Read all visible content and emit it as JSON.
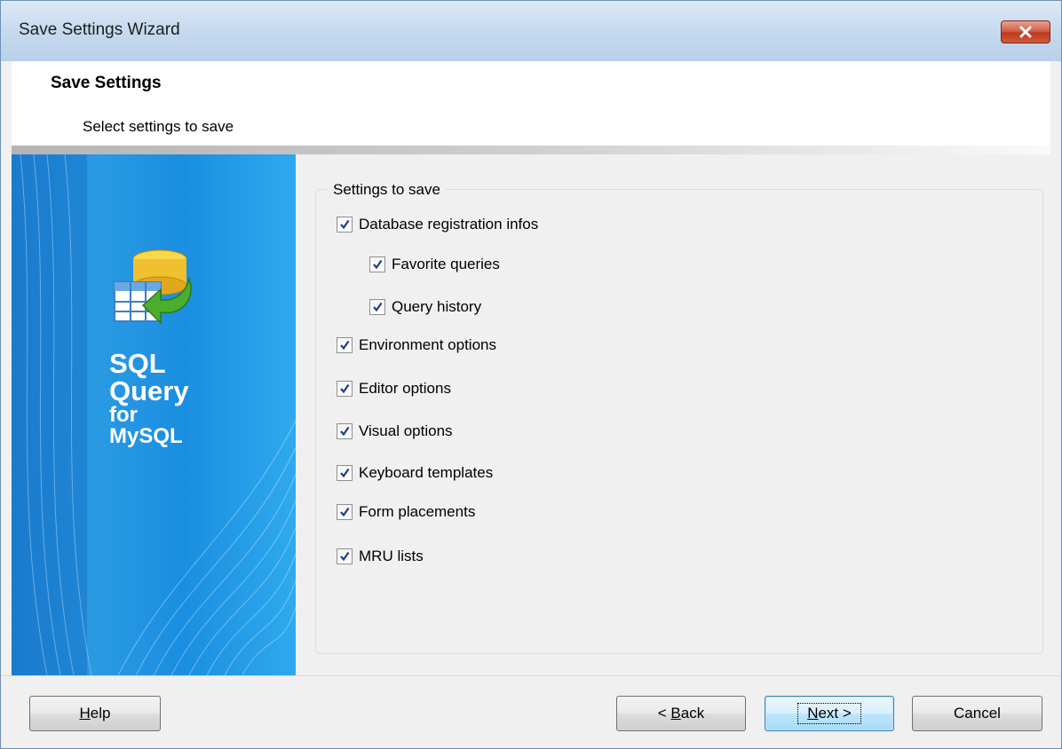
{
  "window": {
    "title": "Save Settings Wizard",
    "close_icon": "close-icon"
  },
  "header": {
    "title": "Save Settings",
    "subtitle": "Select settings to save"
  },
  "banner": {
    "logo_icon": "database-table-arrow-icon",
    "line1": "SQL",
    "line2": "Query",
    "line3": "for",
    "line4": "MySQL"
  },
  "settings": {
    "group_label": "Settings to save",
    "items": [
      {
        "label": "Database registration infos",
        "checked": true,
        "indent": 0
      },
      {
        "label": "Favorite queries",
        "checked": true,
        "indent": 1
      },
      {
        "label": "Query history",
        "checked": true,
        "indent": 1
      },
      {
        "label": "Environment options",
        "checked": true,
        "indent": 0
      },
      {
        "label": "Editor options",
        "checked": true,
        "indent": 0
      },
      {
        "label": "Visual options",
        "checked": true,
        "indent": 0
      },
      {
        "label": "Keyboard templates",
        "checked": true,
        "indent": 0
      },
      {
        "label": "Form placements",
        "checked": true,
        "indent": 0
      },
      {
        "label": "MRU lists",
        "checked": true,
        "indent": 0
      }
    ]
  },
  "footer": {
    "help": {
      "prefix": "",
      "accel": "H",
      "rest": "elp"
    },
    "back": {
      "prefix": "< ",
      "accel": "B",
      "rest": "ack"
    },
    "next": {
      "prefix": "",
      "accel": "N",
      "rest": "ext >"
    },
    "cancel": {
      "label": "Cancel"
    }
  },
  "colors": {
    "banner_blue": "#1a8ee0",
    "title_gradient_top": "#dde9f6",
    "close_red": "#c0391f",
    "default_button": "#bee6fd"
  }
}
